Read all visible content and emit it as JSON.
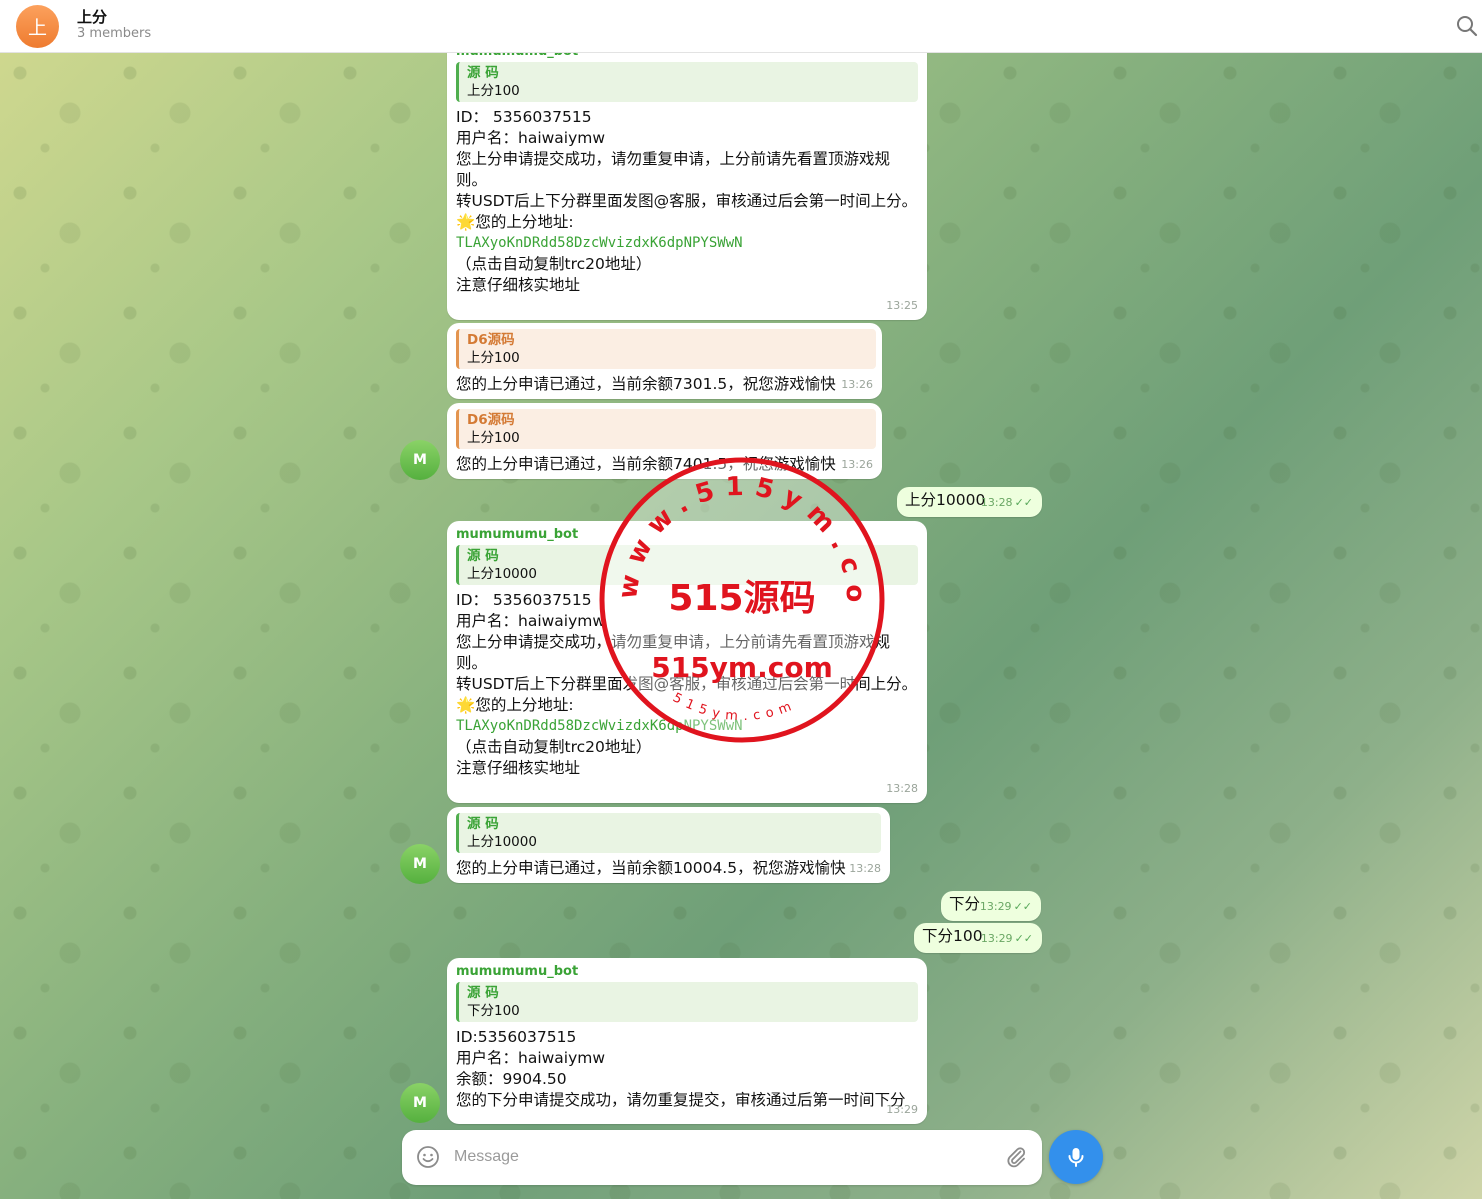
{
  "header": {
    "avatar_letter": "上",
    "title": "上分",
    "subtitle": "3 members"
  },
  "messages": {
    "m1": {
      "sender": "mumumumu_bot",
      "reply_name": "源 码",
      "reply_text": "上分100",
      "id_line": "ID： 5356037515",
      "user_line": "用户名：haiwaiymw",
      "notice1": "您上分申请提交成功，请勿重复申请，上分前请先看置顶游戏规则。",
      "notice2": "转USDT后上下分群里面发图@客服，审核通过后会第一时间上分。",
      "addr_label": "您的上分地址:",
      "address": "TLAXyoKnDRdd58DzcWvizdxK6dpNPYSWwN",
      "copy_hint": "（点击自动复制trc20地址）",
      "verify": "注意仔细核实地址",
      "time": "13:25"
    },
    "m2": {
      "reply_name": "D6源码",
      "reply_text": "上分100",
      "text": "您的上分申请已通过，当前余额7301.5，祝您游戏愉快",
      "time": "13:26"
    },
    "m3": {
      "reply_name": "D6源码",
      "reply_text": "上分100",
      "text": "您的上分申请已通过，当前余额7401.5，祝您游戏愉快",
      "time": "13:26"
    },
    "m4": {
      "text": "上分10000",
      "time": "13:28"
    },
    "m5": {
      "sender": "mumumumu_bot",
      "reply_name": "源 码",
      "reply_text": "上分10000",
      "id_line": "ID： 5356037515",
      "user_line": "用户名：haiwaiymw",
      "notice1": "您上分申请提交成功，请勿重复申请，上分前请先看置顶游戏规则。",
      "notice2": "转USDT后上下分群里面发图@客服，审核通过后会第一时间上分。",
      "addr_label": "您的上分地址:",
      "address": "TLAXyoKnDRdd58DzcWvizdxK6dpNPYSWwN",
      "copy_hint": "（点击自动复制trc20地址）",
      "verify": "注意仔细核实地址",
      "time": "13:28"
    },
    "m6": {
      "reply_name": "源 码",
      "reply_text": "上分10000",
      "text": "您的上分申请已通过，当前余额10004.5，祝您游戏愉快",
      "time": "13:28"
    },
    "m7": {
      "text": "下分",
      "time": "13:29"
    },
    "m8": {
      "text": "下分100",
      "time": "13:29"
    },
    "m9": {
      "sender": "mumumumu_bot",
      "reply_name": "源 码",
      "reply_text": "下分100",
      "id_line": "ID:5356037515",
      "user_line": "用户名：haiwaiymw",
      "balance": "余额：9904.50",
      "text": "您的下分申请提交成功，请勿重复提交，审核通过后第一时间下分",
      "time": "13:29"
    },
    "avatar_letter": "M"
  },
  "stamp": {
    "center_text": "515源码",
    "url_text": "515ym.com",
    "ring_text": "www.515ym.com",
    "small_text": "515ym.com",
    "color": "#e0141e"
  },
  "composer": {
    "placeholder": "Message"
  },
  "colors": {
    "accent": "#3390ec",
    "bot_name": "#3aa336",
    "outgoing_bg": "#eeffde"
  }
}
